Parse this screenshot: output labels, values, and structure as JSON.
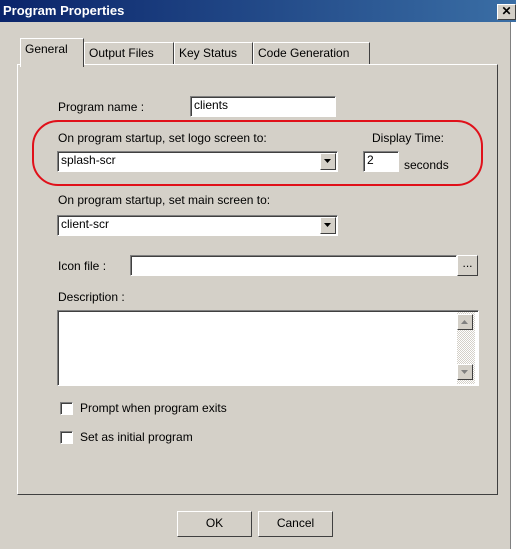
{
  "window": {
    "title": "Program Properties",
    "close_glyph": "✕"
  },
  "tabs": [
    {
      "label": "General",
      "active": true
    },
    {
      "label": "Output Files",
      "active": false
    },
    {
      "label": "Key Status",
      "active": false
    },
    {
      "label": "Code Generation",
      "active": false
    }
  ],
  "general": {
    "program_name_label": "Program name :",
    "program_name_value": "clients",
    "logo_label": "On program startup, set logo screen to:",
    "logo_value": "splash-scr",
    "display_time_label": "Display Time:",
    "display_time_value": "2",
    "seconds_label": "seconds",
    "main_label": "On program startup, set main screen to:",
    "main_value": "client-scr",
    "icon_label": "Icon file :",
    "icon_value": "",
    "browse_label": "...",
    "description_label": "Description :",
    "description_value": "",
    "prompt_exit_label": "Prompt when program exits",
    "prompt_exit_checked": false,
    "initial_program_label": "Set as initial program",
    "initial_program_checked": false
  },
  "buttons": {
    "ok": "OK",
    "cancel": "Cancel"
  },
  "colors": {
    "title_bar": "#0a246a",
    "dialog_bg": "#d4d0c8",
    "highlight_annotation": "#e0101a"
  },
  "icons": [
    "close-icon",
    "dropdown-arrow-icon",
    "scroll-up-icon",
    "scroll-down-icon"
  ]
}
